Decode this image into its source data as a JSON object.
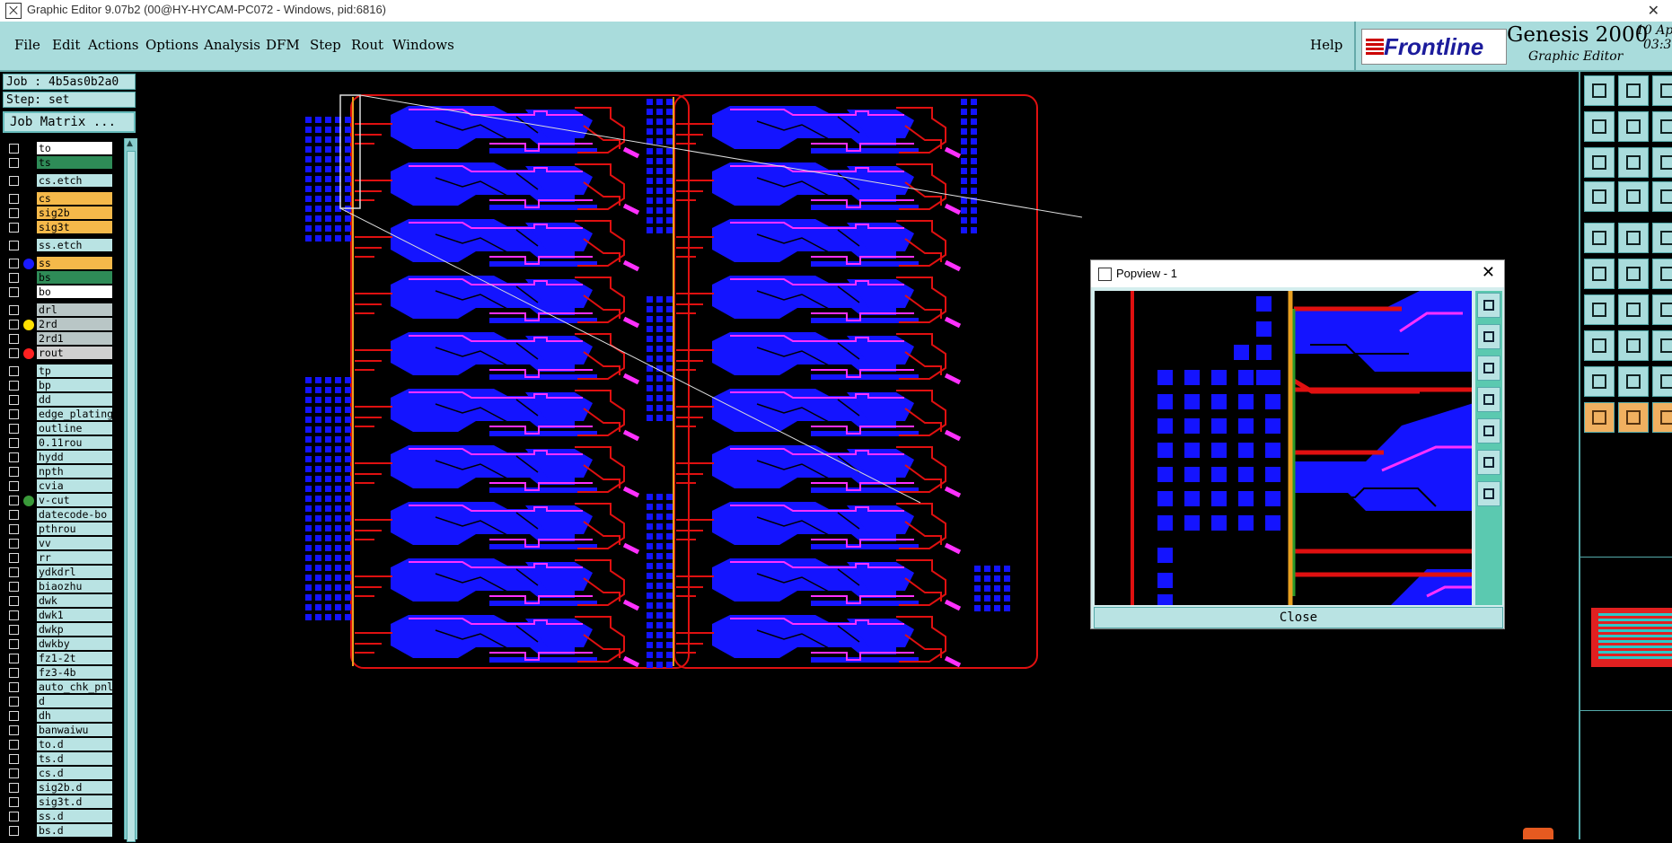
{
  "window": {
    "title": "Graphic Editor 9.07b2 (00@HY-HYCAM-PC072 - Windows, pid:6816)",
    "close_glyph": "✕"
  },
  "menu": [
    "File",
    "Edit",
    "Actions",
    "Options",
    "Analysis",
    "DFM",
    "Step",
    "Rout",
    "Windows"
  ],
  "help_label": "Help",
  "brand": {
    "logo": "Frontline",
    "product": "Genesis 2000",
    "subtitle": "Graphic Editor",
    "date_line1": "10 Ap",
    "date_line2": "03:3"
  },
  "job": {
    "job_label": "Job : 4b5as0b2a0",
    "step_label": "Step: set",
    "matrix_button": "Job Matrix ..."
  },
  "layers": [
    {
      "name": "to",
      "color": "#ffffff"
    },
    {
      "name": "ts",
      "color": "#2e8b57"
    },
    {
      "name": "cs.etch",
      "color": "#b9e3e3"
    },
    {
      "name": "cs",
      "color": "#f5b94a"
    },
    {
      "name": "sig2b",
      "color": "#f5b94a"
    },
    {
      "name": "sig3t",
      "color": "#f5b94a"
    },
    {
      "name": "ss.etch",
      "color": "#b9e3e3"
    },
    {
      "name": "ss",
      "color": "#f5b94a",
      "dot": "#1a1aff"
    },
    {
      "name": "bs",
      "color": "#2e8b57"
    },
    {
      "name": "bo",
      "color": "#ffffff"
    },
    {
      "name": "drl",
      "color": "#b9c6c6"
    },
    {
      "name": "2rd",
      "color": "#b9c6c6",
      "dot": "#ffe000"
    },
    {
      "name": "2rd1",
      "color": "#b9c6c6"
    },
    {
      "name": "rout",
      "color": "#d0d0d0",
      "dot": "#ff2020"
    },
    {
      "name": "tp",
      "color": "#b9e3e3"
    },
    {
      "name": "bp",
      "color": "#b9e3e3"
    },
    {
      "name": "dd",
      "color": "#b9e3e3"
    },
    {
      "name": "edge_plating",
      "color": "#b9e3e3"
    },
    {
      "name": "outline",
      "color": "#b9e3e3"
    },
    {
      "name": "0.11rou",
      "color": "#b9e3e3"
    },
    {
      "name": "hydd",
      "color": "#b9e3e3"
    },
    {
      "name": "npth",
      "color": "#b9e3e3"
    },
    {
      "name": "cvia",
      "color": "#b9e3e3"
    },
    {
      "name": "v-cut",
      "color": "#b9e3e3",
      "dot": "#3a9a3a"
    },
    {
      "name": "datecode-bo",
      "color": "#b9e3e3"
    },
    {
      "name": "pthrou",
      "color": "#b9e3e3"
    },
    {
      "name": "vv",
      "color": "#b9e3e3"
    },
    {
      "name": "rr",
      "color": "#b9e3e3"
    },
    {
      "name": "ydkdrl",
      "color": "#b9e3e3"
    },
    {
      "name": "biaozhu",
      "color": "#b9e3e3"
    },
    {
      "name": "dwk",
      "color": "#b9e3e3"
    },
    {
      "name": "dwk1",
      "color": "#b9e3e3"
    },
    {
      "name": "dwkp",
      "color": "#b9e3e3"
    },
    {
      "name": "dwkby",
      "color": "#b9e3e3"
    },
    {
      "name": "fz1-2t",
      "color": "#b9e3e3"
    },
    {
      "name": "fz3-4b",
      "color": "#b9e3e3"
    },
    {
      "name": "auto_chk_pnl",
      "color": "#b9e3e3"
    },
    {
      "name": "d",
      "color": "#b9e3e3"
    },
    {
      "name": "dh",
      "color": "#b9e3e3"
    },
    {
      "name": "banwaiwu",
      "color": "#b9e3e3"
    },
    {
      "name": "to.d",
      "color": "#b9e3e3"
    },
    {
      "name": "ts.d",
      "color": "#b9e3e3"
    },
    {
      "name": "cs.d",
      "color": "#b9e3e3"
    },
    {
      "name": "sig2b.d",
      "color": "#b9e3e3"
    },
    {
      "name": "sig3t.d",
      "color": "#b9e3e3"
    },
    {
      "name": "ss.d",
      "color": "#b9e3e3"
    },
    {
      "name": "bs.d",
      "color": "#b9e3e3"
    }
  ],
  "popview": {
    "title": "Popview - 1",
    "close_button": "Close",
    "close_glyph": "✕"
  },
  "colors": {
    "trace": "#e01010",
    "copper": "#1414ff",
    "highlight": "#ff30ff",
    "outline": "#e8a020",
    "panel": "#a9dcdc"
  }
}
